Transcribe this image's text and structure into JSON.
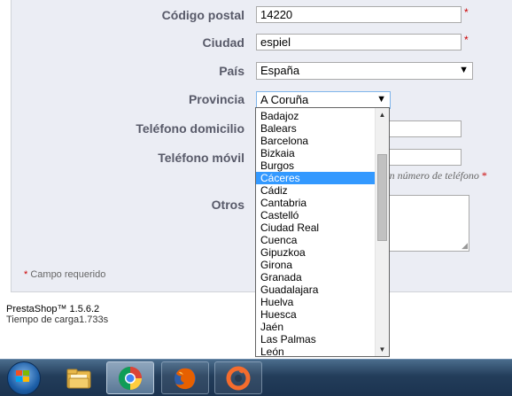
{
  "form": {
    "postal_code": {
      "label": "Código postal",
      "value": "14220"
    },
    "city": {
      "label": "Ciudad",
      "value": "espiel"
    },
    "country": {
      "label": "País",
      "value": "España"
    },
    "province": {
      "label": "Provincia",
      "value": "A Coruña"
    },
    "home_phone": {
      "label": "Teléfono domicilio",
      "value": ""
    },
    "mobile_phone": {
      "label": "Teléfono móvil",
      "value": ""
    },
    "phone_hint": "os un número de teléfono",
    "other": {
      "label": "Otros",
      "value": ""
    },
    "required_marker": "*",
    "required_note": "Campo requerido"
  },
  "dropdown": {
    "selected": "Cáceres",
    "options": [
      "Badajoz",
      "Balears",
      "Barcelona",
      "Bizkaia",
      "Burgos",
      "Cáceres",
      "Cádiz",
      "Cantabria",
      "Castelló",
      "Ciudad Real",
      "Cuenca",
      "Gipuzkoa",
      "Girona",
      "Granada",
      "Guadalajara",
      "Huelva",
      "Huesca",
      "Jaén",
      "Las Palmas",
      "León"
    ]
  },
  "footer": {
    "platform": "PrestaShop™ 1.5.6.2",
    "load_time": "Tiempo de carga1.733s"
  },
  "taskbar": {
    "items": [
      "file-explorer",
      "chrome",
      "firefox",
      "origin"
    ],
    "active": "chrome"
  },
  "colors": {
    "panel_bg": "#ebedf4",
    "label": "#585a69",
    "required": "#cc0000",
    "selection": "#3399ff"
  }
}
